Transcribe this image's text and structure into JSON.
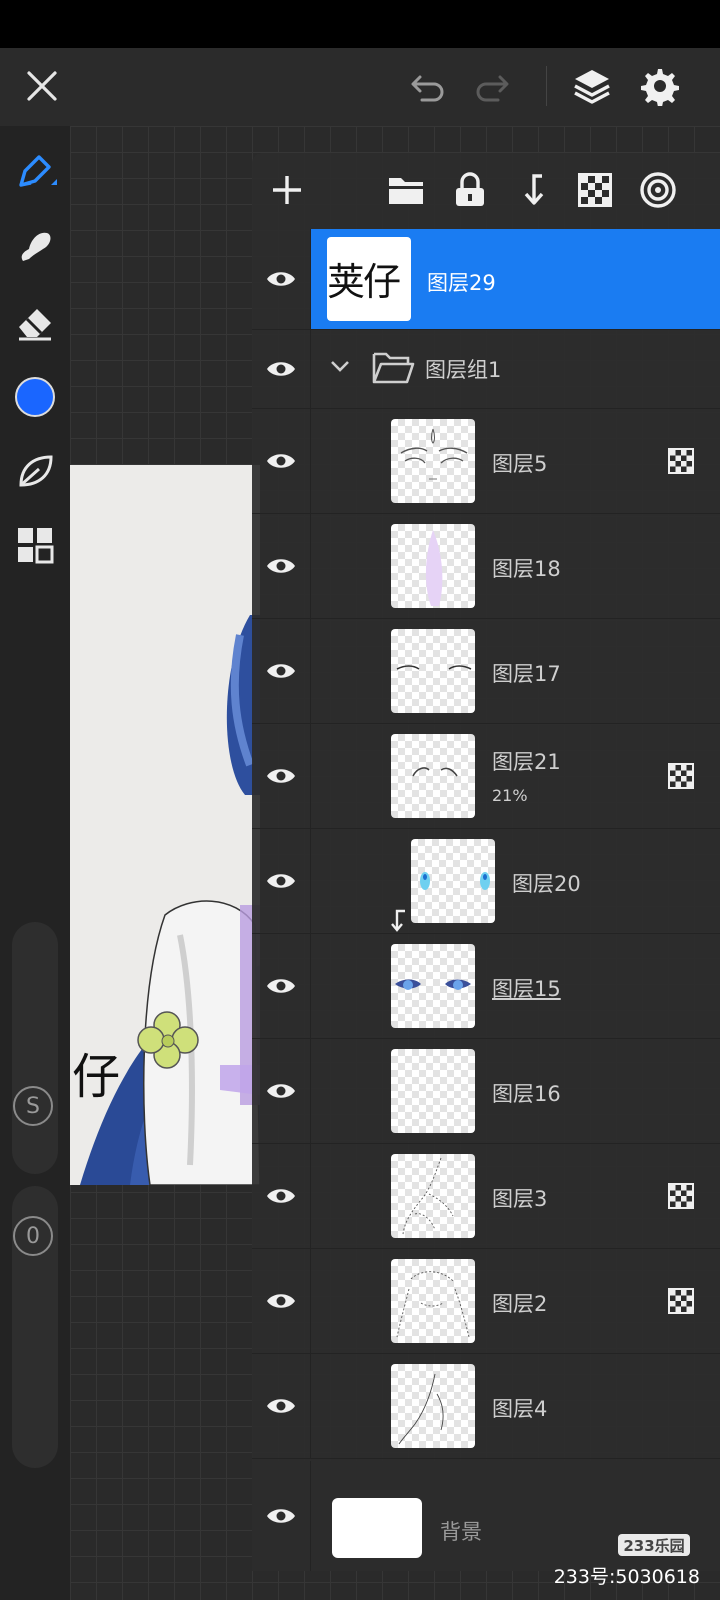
{
  "topbar": {
    "close_icon": "close-icon",
    "undo_icon": "undo-icon",
    "redo_icon": "redo-icon",
    "layers_icon": "layers-icon",
    "settings_icon": "gear-icon"
  },
  "toolbar": {
    "tools": [
      "pen-icon",
      "smudge-icon",
      "eraser-icon",
      "color-swatch",
      "leaf-icon",
      "grid-icon"
    ],
    "active_color": "#1a66ff",
    "size_badge": "S",
    "opacity_badge": "0"
  },
  "artwork": {
    "text_fragment": "仔"
  },
  "layers_panel": {
    "tools": [
      "add-icon",
      "folder-icon",
      "lock-icon",
      "merge-down-icon",
      "alpha-lock-icon",
      "target-icon"
    ],
    "layers": [
      {
        "name": "图层29",
        "thumb_text": "荚仔",
        "selected": true
      },
      {
        "name": "图层组1",
        "group": true
      },
      {
        "name": "图层5",
        "alpha_lock": true
      },
      {
        "name": "图层18"
      },
      {
        "name": "图层17"
      },
      {
        "name": "图层21",
        "opacity": "21%",
        "alpha_lock": true
      },
      {
        "name": "图层20",
        "clipped": true
      },
      {
        "name": "图层15"
      },
      {
        "name": "图层16"
      },
      {
        "name": "图层3",
        "alpha_lock": true
      },
      {
        "name": "图层2",
        "alpha_lock": true
      },
      {
        "name": "图层4"
      }
    ],
    "background_layer": "背景"
  },
  "watermark": {
    "logo": "233乐园",
    "text": "233号:5030618"
  }
}
